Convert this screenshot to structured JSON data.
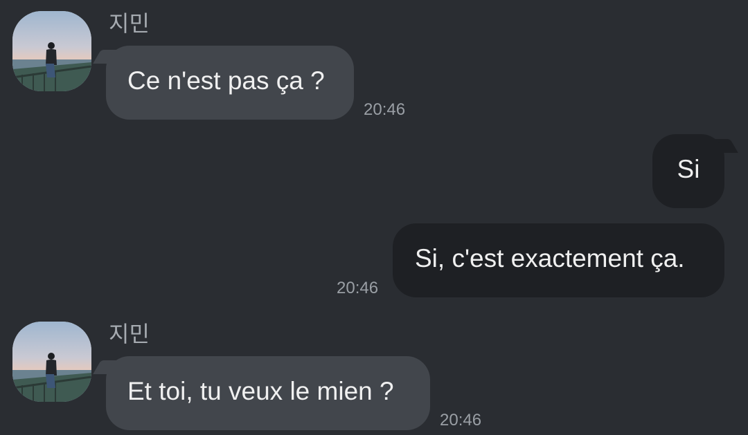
{
  "messages": [
    {
      "sender": "지민",
      "text": "Ce n'est pas ça ?",
      "time": "20:46",
      "direction": "incoming"
    },
    {
      "text": "Si",
      "direction": "outgoing"
    },
    {
      "text": "Si, c'est exactement ça.",
      "time": "20:46",
      "direction": "outgoing"
    },
    {
      "sender": "지민",
      "text": "Et toi, tu veux le mien ?",
      "time": "20:46",
      "direction": "incoming"
    }
  ],
  "colors": {
    "background": "#2a2d32",
    "incoming_bubble": "#42464c",
    "outgoing_bubble": "#1e2024",
    "text": "#f0f0f0",
    "meta_text": "#9a9fa5"
  }
}
